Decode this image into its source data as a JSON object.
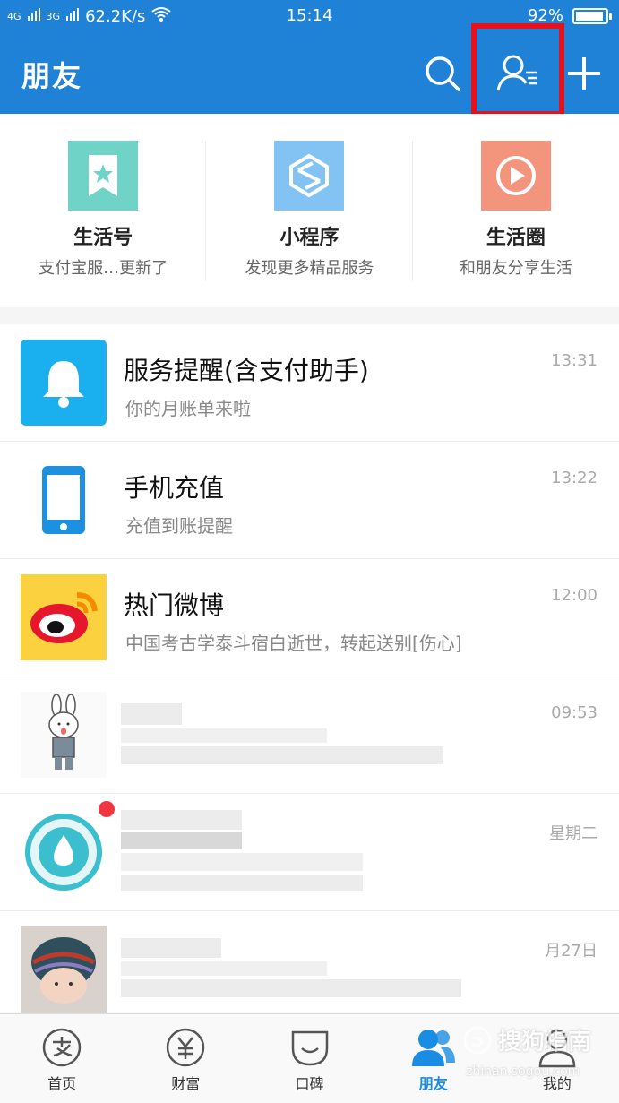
{
  "status_bar": {
    "signal_1": "4G",
    "signal_2": "3G",
    "speed": "62.2K/s",
    "time": "15:14",
    "battery": "92%"
  },
  "header": {
    "title": "朋友"
  },
  "entries": [
    {
      "name": "生活号",
      "desc": "支付宝服…更新了",
      "color": "#6fd3c7",
      "icon": "bookmark-star-icon"
    },
    {
      "name": "小程序",
      "desc": "发现更多精品服务",
      "color": "#82c3f3",
      "icon": "mini-program-icon"
    },
    {
      "name": "生活圈",
      "desc": "和朋友分享生活",
      "color": "#f3957c",
      "icon": "play-circle-icon"
    }
  ],
  "list": [
    {
      "name": "服务提醒(含支付助手)",
      "msg": "你的月账单来啦",
      "time": "13:31"
    },
    {
      "name": "手机充值",
      "msg": "充值到账提醒",
      "time": "13:22"
    },
    {
      "name": "热门微博",
      "msg": "中国考古学泰斗宿白逝世，转起送别[伤心]",
      "time": "12:00"
    },
    {
      "name": "",
      "msg": "",
      "time": "09:53"
    },
    {
      "name": "",
      "msg": "",
      "time": "星期二"
    },
    {
      "name": "",
      "msg": "",
      "time": "月27日"
    }
  ],
  "tabs": [
    {
      "label": "首页",
      "icon": "home-alipay-icon"
    },
    {
      "label": "财富",
      "icon": "wealth-yuan-icon"
    },
    {
      "label": "口碑",
      "icon": "koubei-icon"
    },
    {
      "label": "朋友",
      "icon": "friends-icon"
    },
    {
      "label": "我的",
      "icon": "profile-icon"
    }
  ],
  "watermark": {
    "main": "搜狗指南",
    "sub": "zhinan.sogou.com"
  }
}
